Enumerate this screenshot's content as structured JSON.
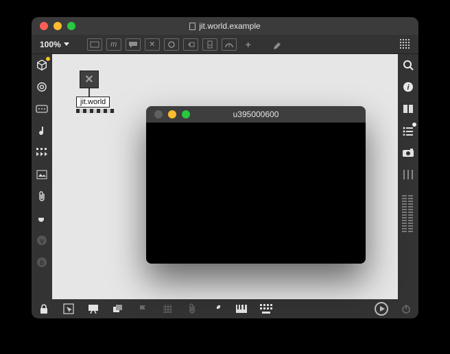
{
  "window": {
    "title": "jit.world.example",
    "zoom_label": "100%"
  },
  "patch": {
    "obj_label": "jit.world"
  },
  "float_window": {
    "title": "u395000600"
  },
  "icons": {
    "cube": "cube-icon",
    "target": "target-icon"
  },
  "colors": {
    "bg_dark": "#333333",
    "canvas": "#e6e6e6",
    "accent_yellow": "#f5c518"
  }
}
